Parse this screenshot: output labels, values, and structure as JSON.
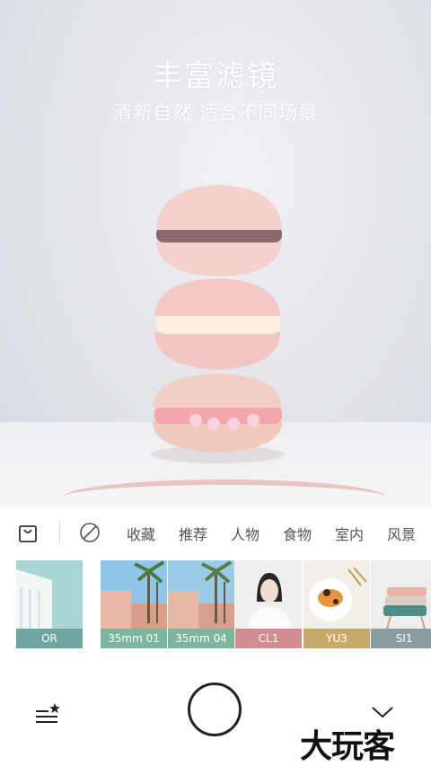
{
  "hero": {
    "title": "丰富滤镜",
    "subtitle": "清新自然 适合不同场景"
  },
  "categories": {
    "store_icon": "shopping-bag-icon",
    "none_icon": "no-filter-icon",
    "items": [
      "收藏",
      "推荐",
      "人物",
      "食物",
      "室内",
      "风景"
    ]
  },
  "filters": [
    {
      "label": "OR",
      "color": "#6fa6a0",
      "icon": "building-thumb"
    },
    {
      "label": "35mm 01",
      "color": "#7ab79e",
      "icon": "palm-thumb"
    },
    {
      "label": "35mm 04",
      "color": "#7ab79e",
      "icon": "palm-thumb"
    },
    {
      "label": "CL1",
      "color": "#d28d93",
      "icon": "portrait-thumb"
    },
    {
      "label": "YU3",
      "color": "#c9a96a",
      "icon": "food-thumb"
    },
    {
      "label": "SI1",
      "color": "#8a9ca0",
      "icon": "stack-thumb"
    }
  ],
  "bottom": {
    "menu_icon": "filter-list-star-icon",
    "shutter": "shutter-button",
    "collapse_icon": "chevron-down-icon",
    "watermark": "大玩客"
  }
}
